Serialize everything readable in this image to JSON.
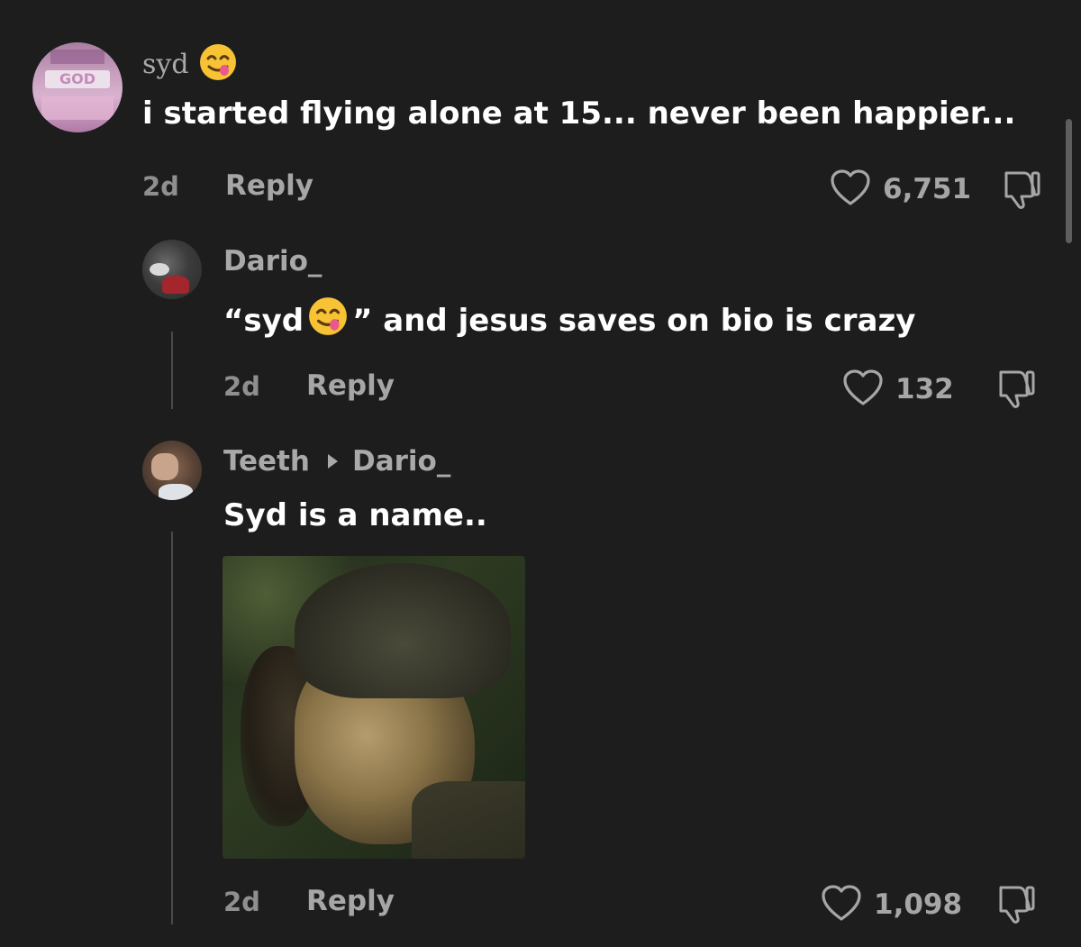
{
  "comments": [
    {
      "username": "syd",
      "text": "i started flying alone at 15... never been happier...",
      "time": "2d",
      "reply_label": "Reply",
      "likes": "6,751"
    },
    {
      "username": "Dario_",
      "text_before_emoji": "“syd",
      "text_after_emoji": "” and jesus saves on bio is crazy",
      "time": "2d",
      "reply_label": "Reply",
      "likes": "132"
    },
    {
      "username": "Teeth",
      "reply_to": "Dario_",
      "text": "Syd is a name..",
      "time": "2d",
      "reply_label": "Reply",
      "likes": "1,098"
    }
  ],
  "avatar_text": "GOD",
  "icons": [
    "heart-outline-icon",
    "thumbs-down-icon",
    "smiling-face-with-tongue-emoji"
  ],
  "colors": {
    "background": "#1d1d1d",
    "text_primary": "#ffffff",
    "text_secondary": "#a6a6a6",
    "emoji_yellow": "#f7c234",
    "tongue": "#e85a8a"
  }
}
